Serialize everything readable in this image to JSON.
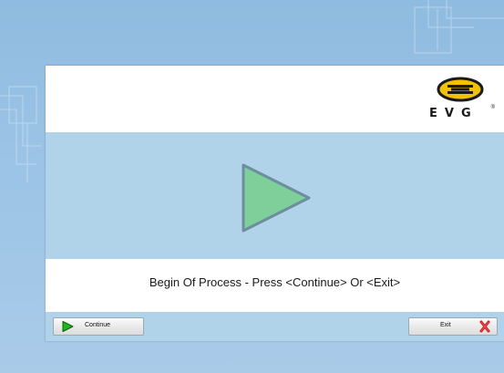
{
  "logo": {
    "text": "EVG",
    "registered": "®"
  },
  "main": {
    "status_icon": "play-icon",
    "message": "Begin Of Process - Press <Continue> Or <Exit>"
  },
  "buttons": {
    "continue_label": "Continue",
    "continue_icon": "play-icon",
    "exit_label": "Exit",
    "exit_icon": "red-x-icon"
  },
  "colors": {
    "band": "#b1d3e9",
    "play_fill": "#7fcf9a",
    "play_stroke": "#6c8ea0",
    "continue_icon_fill": "#1fb81f",
    "exit_icon": "#c8171b",
    "logo_yellow": "#f2c200"
  }
}
